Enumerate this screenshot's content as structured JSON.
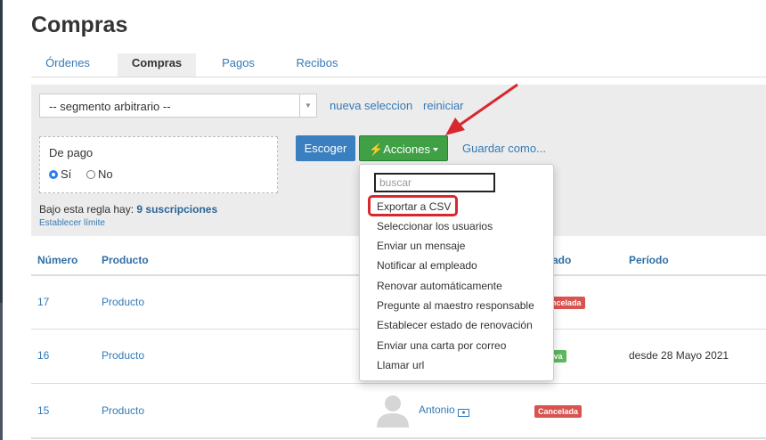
{
  "page_title": "Compras",
  "tabs": [
    {
      "label": "Órdenes"
    },
    {
      "label": "Compras"
    },
    {
      "label": "Pagos"
    },
    {
      "label": "Recibos"
    }
  ],
  "filters": {
    "segment_select": "-- segmento arbitrario --",
    "new_selection": "nueva seleccion",
    "reset": "reiniciar",
    "payment_label": "De pago",
    "radio_yes": "Sí",
    "radio_no": "No",
    "choose_button": "Escoger",
    "actions_button": "Acciones",
    "save_as": "Guardar como...",
    "rule_text": "Bajo esta regla hay:",
    "rule_count": "9 suscripciones",
    "set_limit": "Establecer límite"
  },
  "table": {
    "columns": [
      "Número",
      "Producto",
      "ado",
      "Período"
    ],
    "rows": [
      {
        "number": "17",
        "product": "Producto",
        "status": "ncelada",
        "period": ""
      },
      {
        "number": "16",
        "product": "Producto",
        "status": "iva",
        "period": "desde 28 Mayo 2021"
      },
      {
        "number": "15",
        "product": "Producto",
        "user": "Antonio",
        "status": "Cancelada",
        "period": ""
      }
    ]
  },
  "dropdown": {
    "search_placeholder": "buscar",
    "items": [
      "Exportar a CSV",
      "Seleccionar los usuarios",
      "Enviar un mensaje",
      "Notificar al empleado",
      "Renovar automáticamente",
      "Pregunte al maestro responsable",
      "Establecer estado de renovación",
      "Enviar una carta por correo",
      "Llamar url"
    ]
  },
  "colors": {
    "link": "#337ab7",
    "primary_button": "#3a7fbf",
    "success_button": "#3fa045",
    "annotation": "#d9272e"
  }
}
